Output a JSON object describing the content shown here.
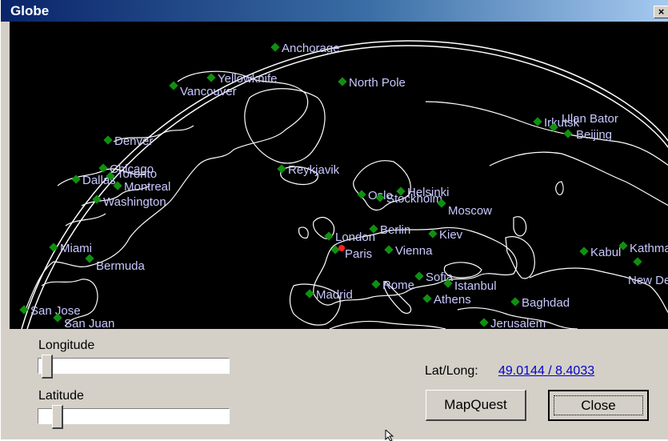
{
  "window": {
    "title": "Globe",
    "close_glyph": "×"
  },
  "globe": {
    "selected_city_color": "#ff2020",
    "city_color": "#109010",
    "cities": [
      {
        "name": "Anchorage"
      },
      {
        "name": "Yellowknife"
      },
      {
        "name": "Vancouver"
      },
      {
        "name": "North Pole"
      },
      {
        "name": "Irkutsk"
      },
      {
        "name": "Ulan Bator"
      },
      {
        "name": "Beijing"
      },
      {
        "name": "Denver"
      },
      {
        "name": "Chicago"
      },
      {
        "name": "Dallas"
      },
      {
        "name": "Toronto"
      },
      {
        "name": "Montreal"
      },
      {
        "name": "Washington"
      },
      {
        "name": "Reykjavik"
      },
      {
        "name": "Oslo"
      },
      {
        "name": "Stockholm"
      },
      {
        "name": "Helsinki"
      },
      {
        "name": "Moscow"
      },
      {
        "name": "London"
      },
      {
        "name": "Berlin"
      },
      {
        "name": "Kiev"
      },
      {
        "name": "Paris"
      },
      {
        "name": "Vienna"
      },
      {
        "name": "Miami"
      },
      {
        "name": "Bermuda"
      },
      {
        "name": "Kabul"
      },
      {
        "name": "Kathmandu"
      },
      {
        "name": "New Delhi"
      },
      {
        "name": "Sofia"
      },
      {
        "name": "Istanbul"
      },
      {
        "name": "Madrid"
      },
      {
        "name": "Rome"
      },
      {
        "name": "Athens"
      },
      {
        "name": "Baghdad"
      },
      {
        "name": "San Jose"
      },
      {
        "name": "San Juan"
      },
      {
        "name": "Jerusalem"
      }
    ]
  },
  "controls": {
    "longitude_label": "Longitude",
    "latitude_label": "Latitude",
    "longitude_level": 0.02,
    "latitude_level": 0.08,
    "latlong_label": "Lat/Long:",
    "latlong_value": "49.0144 / 8.4033",
    "mapquest_button": "MapQuest",
    "close_button": "Close"
  }
}
